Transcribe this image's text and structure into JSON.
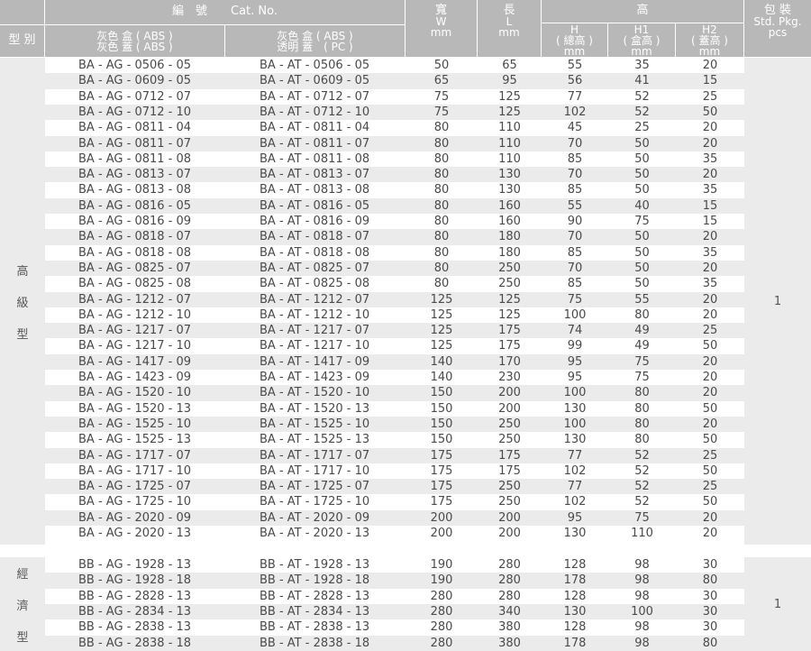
{
  "header": {
    "type_label": "型 別",
    "catno_label": "編　號　　Cat. No.",
    "box_col": [
      "灰色 盒 ( ABS )",
      "灰色 蓋 ( ABS )"
    ],
    "lid_col": [
      "灰色 盒 ( ABS )",
      "透明 蓋　( PC )"
    ],
    "width_col": [
      "寬",
      "W",
      "mm"
    ],
    "length_col": [
      "長",
      "L",
      "mm"
    ],
    "height_group": "高",
    "h_col": [
      "H",
      "( 總高 )",
      "mm"
    ],
    "h1_col": [
      "H1",
      "( 盒高 )",
      "mm"
    ],
    "h2_col": [
      "H2",
      "( 蓋高 )",
      "mm"
    ],
    "pkg_col": [
      "包 裝",
      "Std. Pkg.",
      "pcs"
    ]
  },
  "groups": [
    {
      "type_chars": [
        "高",
        "級",
        "型"
      ],
      "pkg": "1",
      "rows": [
        [
          "BA - AG - 0506 - 05",
          "BA - AT - 0506 - 05",
          "50",
          "65",
          "55",
          "35",
          "20"
        ],
        [
          "BA - AG - 0609 - 05",
          "BA - AT - 0609 - 05",
          "65",
          "95",
          "56",
          "41",
          "15"
        ],
        [
          "BA - AG - 0712 - 07",
          "BA - AT - 0712 - 07",
          "75",
          "125",
          "77",
          "52",
          "25"
        ],
        [
          "BA - AG - 0712 - 10",
          "BA - AT - 0712 - 10",
          "75",
          "125",
          "102",
          "52",
          "50"
        ],
        [
          "BA - AG - 0811 - 04",
          "BA - AT - 0811 - 04",
          "80",
          "110",
          "45",
          "25",
          "20"
        ],
        [
          "BA - AG - 0811 - 07",
          "BA - AT - 0811 - 07",
          "80",
          "110",
          "70",
          "50",
          "20"
        ],
        [
          "BA - AG - 0811 - 08",
          "BA - AT - 0811 - 08",
          "80",
          "110",
          "85",
          "50",
          "35"
        ],
        [
          "BA - AG - 0813 - 07",
          "BA - AT - 0813 - 07",
          "80",
          "130",
          "70",
          "50",
          "20"
        ],
        [
          "BA - AG - 0813 - 08",
          "BA - AT - 0813 - 08",
          "80",
          "130",
          "85",
          "50",
          "35"
        ],
        [
          "BA - AG - 0816 - 05",
          "BA - AT - 0816 - 05",
          "80",
          "160",
          "55",
          "40",
          "15"
        ],
        [
          "BA - AG - 0816 - 09",
          "BA - AT - 0816 - 09",
          "80",
          "160",
          "90",
          "75",
          "15"
        ],
        [
          "BA - AG - 0818 - 07",
          "BA - AT - 0818 - 07",
          "80",
          "180",
          "70",
          "50",
          "20"
        ],
        [
          "BA - AG - 0818 - 08",
          "BA - AT - 0818 - 08",
          "80",
          "180",
          "85",
          "50",
          "35"
        ],
        [
          "BA - AG - 0825 - 07",
          "BA - AT - 0825 - 07",
          "80",
          "250",
          "70",
          "50",
          "20"
        ],
        [
          "BA - AG - 0825 - 08",
          "BA - AT - 0825 - 08",
          "80",
          "250",
          "85",
          "50",
          "35"
        ],
        [
          "BA - AG - 1212 - 07",
          "BA - AT - 1212 - 07",
          "125",
          "125",
          "75",
          "55",
          "20"
        ],
        [
          "BA - AG - 1212 - 10",
          "BA - AT - 1212 - 10",
          "125",
          "125",
          "100",
          "80",
          "20"
        ],
        [
          "BA - AG - 1217 - 07",
          "BA - AT - 1217 - 07",
          "125",
          "175",
          "74",
          "49",
          "25"
        ],
        [
          "BA - AG - 1217 - 10",
          "BA - AT - 1217 - 10",
          "125",
          "175",
          "99",
          "49",
          "50"
        ],
        [
          "BA - AG - 1417 - 09",
          "BA - AT - 1417 - 09",
          "140",
          "170",
          "95",
          "75",
          "20"
        ],
        [
          "BA - AG - 1423 - 09",
          "BA - AT - 1423 - 09",
          "140",
          "230",
          "95",
          "75",
          "20"
        ],
        [
          "BA - AG - 1520 - 10",
          "BA - AT - 1520 - 10",
          "150",
          "200",
          "100",
          "80",
          "20"
        ],
        [
          "BA - AG - 1520 - 13",
          "BA - AT - 1520 - 13",
          "150",
          "200",
          "130",
          "80",
          "50"
        ],
        [
          "BA - AG - 1525 - 10",
          "BA - AT - 1525 - 10",
          "150",
          "250",
          "100",
          "80",
          "20"
        ],
        [
          "BA - AG - 1525 - 13",
          "BA - AT - 1525 - 13",
          "150",
          "250",
          "130",
          "80",
          "50"
        ],
        [
          "BA - AG - 1717 - 07",
          "BA - AT - 1717 - 07",
          "175",
          "175",
          "77",
          "52",
          "25"
        ],
        [
          "BA - AG - 1717 - 10",
          "BA - AT - 1717 - 10",
          "175",
          "175",
          "102",
          "52",
          "50"
        ],
        [
          "BA - AG - 1725 - 07",
          "BA - AT - 1725 - 07",
          "175",
          "250",
          "77",
          "52",
          "25"
        ],
        [
          "BA - AG - 1725 - 10",
          "BA - AT - 1725 - 10",
          "175",
          "250",
          "102",
          "52",
          "50"
        ],
        [
          "BA - AG - 2020 - 09",
          "BA - AT - 2020 - 09",
          "200",
          "200",
          "95",
          "75",
          "20"
        ],
        [
          "BA - AG - 2020 - 13",
          "BA - AT - 2020 - 13",
          "200",
          "200",
          "130",
          "110",
          "20"
        ]
      ]
    },
    {
      "type_chars": [
        "經",
        "濟",
        "型"
      ],
      "pkg": "1",
      "rows": [
        [
          "BB - AG - 1928 - 13",
          "BB - AT - 1928 - 13",
          "190",
          "280",
          "128",
          "98",
          "30"
        ],
        [
          "BB - AG - 1928 - 18",
          "BB - AT - 1928 - 18",
          "190",
          "280",
          "178",
          "98",
          "80"
        ],
        [
          "BB - AG - 2828 - 13",
          "BB - AT - 2828 - 13",
          "280",
          "280",
          "128",
          "98",
          "30"
        ],
        [
          "BB - AG - 2834 - 13",
          "BB - AT - 2834 - 13",
          "280",
          "340",
          "130",
          "100",
          "30"
        ],
        [
          "BB - AG - 2838 - 13",
          "BB - AT - 2838 - 13",
          "280",
          "380",
          "128",
          "98",
          "30"
        ],
        [
          "BB - AG - 2838 - 18",
          "BB - AT - 2838 - 18",
          "280",
          "380",
          "178",
          "98",
          "80"
        ]
      ]
    }
  ]
}
